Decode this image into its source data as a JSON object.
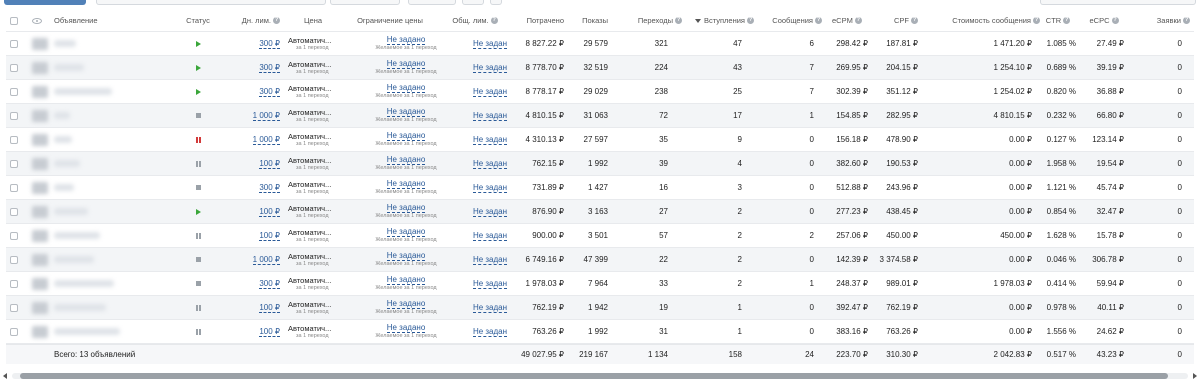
{
  "header": {
    "ad": "Объявление",
    "status": "Статус",
    "daily_limit": "Дн. лим.",
    "price": "Цена",
    "price_limit": "Ограничение цены",
    "total_limit": "Общ. лим.",
    "spent": "Потрачено",
    "impressions": "Показы",
    "clicks": "Переходы",
    "joins": "Вступления",
    "messages": "Сообщения",
    "ecpm": "eCPM",
    "cpf": "CPF",
    "message_cost": "Стоимость сообщения",
    "ctr": "CTR",
    "ecpc": "eCPC",
    "leads": "Заявки",
    "help_glyph": "?"
  },
  "price_main": "Автоматич...",
  "price_sub": "за 1 переход",
  "price_limit_link": "Не задано",
  "price_limit_sub": "Желаемое за 1 переход",
  "total_limit_link": "Не задан",
  "rows": [
    {
      "status": "play",
      "daily": "300 ₽",
      "spent": "8 827.22 ₽",
      "impr": "29 579",
      "clicks": "321",
      "joins": "47",
      "msgs": "6",
      "ecpm": "298.42 ₽",
      "cpf": "187.81 ₽",
      "mcost": "1 471.20 ₽",
      "ctr": "1.085 %",
      "ecpc": "27.49 ₽",
      "leads": "0"
    },
    {
      "status": "play",
      "daily": "300 ₽",
      "spent": "8 778.70 ₽",
      "impr": "32 519",
      "clicks": "224",
      "joins": "43",
      "msgs": "7",
      "ecpm": "269.95 ₽",
      "cpf": "204.15 ₽",
      "mcost": "1 254.10 ₽",
      "ctr": "0.689 %",
      "ecpc": "39.19 ₽",
      "leads": "0"
    },
    {
      "status": "play",
      "daily": "300 ₽",
      "spent": "8 778.17 ₽",
      "impr": "29 029",
      "clicks": "238",
      "joins": "25",
      "msgs": "7",
      "ecpm": "302.39 ₽",
      "cpf": "351.12 ₽",
      "mcost": "1 254.02 ₽",
      "ctr": "0.820 %",
      "ecpc": "36.88 ₽",
      "leads": "0"
    },
    {
      "status": "stop",
      "daily": "1 000 ₽",
      "spent": "4 810.15 ₽",
      "impr": "31 063",
      "clicks": "72",
      "joins": "17",
      "msgs": "1",
      "ecpm": "154.85 ₽",
      "cpf": "282.95 ₽",
      "mcost": "4 810.15 ₽",
      "ctr": "0.232 %",
      "ecpc": "66.80 ₽",
      "leads": "0"
    },
    {
      "status": "pause-red",
      "daily": "1 000 ₽",
      "spent": "4 310.13 ₽",
      "impr": "27 597",
      "clicks": "35",
      "joins": "9",
      "msgs": "0",
      "ecpm": "156.18 ₽",
      "cpf": "478.90 ₽",
      "mcost": "0.00 ₽",
      "ctr": "0.127 %",
      "ecpc": "123.14 ₽",
      "leads": "0"
    },
    {
      "status": "pause",
      "daily": "100 ₽",
      "spent": "762.15 ₽",
      "impr": "1 992",
      "clicks": "39",
      "joins": "4",
      "msgs": "0",
      "ecpm": "382.60 ₽",
      "cpf": "190.53 ₽",
      "mcost": "0.00 ₽",
      "ctr": "1.958 %",
      "ecpc": "19.54 ₽",
      "leads": "0"
    },
    {
      "status": "stop",
      "daily": "300 ₽",
      "spent": "731.89 ₽",
      "impr": "1 427",
      "clicks": "16",
      "joins": "3",
      "msgs": "0",
      "ecpm": "512.88 ₽",
      "cpf": "243.96 ₽",
      "mcost": "0.00 ₽",
      "ctr": "1.121 %",
      "ecpc": "45.74 ₽",
      "leads": "0"
    },
    {
      "status": "play",
      "daily": "100 ₽",
      "spent": "876.90 ₽",
      "impr": "3 163",
      "clicks": "27",
      "joins": "2",
      "msgs": "0",
      "ecpm": "277.23 ₽",
      "cpf": "438.45 ₽",
      "mcost": "0.00 ₽",
      "ctr": "0.854 %",
      "ecpc": "32.47 ₽",
      "leads": "0"
    },
    {
      "status": "pause",
      "daily": "100 ₽",
      "spent": "900.00 ₽",
      "impr": "3 501",
      "clicks": "57",
      "joins": "2",
      "msgs": "2",
      "ecpm": "257.06 ₽",
      "cpf": "450.00 ₽",
      "mcost": "450.00 ₽",
      "ctr": "1.628 %",
      "ecpc": "15.78 ₽",
      "leads": "0"
    },
    {
      "status": "stop",
      "daily": "1 000 ₽",
      "spent": "6 749.16 ₽",
      "impr": "47 399",
      "clicks": "22",
      "joins": "2",
      "msgs": "0",
      "ecpm": "142.39 ₽",
      "cpf": "3 374.58 ₽",
      "mcost": "0.00 ₽",
      "ctr": "0.046 %",
      "ecpc": "306.78 ₽",
      "leads": "0"
    },
    {
      "status": "stop",
      "daily": "300 ₽",
      "spent": "1 978.03 ₽",
      "impr": "7 964",
      "clicks": "33",
      "joins": "2",
      "msgs": "1",
      "ecpm": "248.37 ₽",
      "cpf": "989.01 ₽",
      "mcost": "1 978.03 ₽",
      "ctr": "0.414 %",
      "ecpc": "59.94 ₽",
      "leads": "0"
    },
    {
      "status": "pause",
      "daily": "100 ₽",
      "spent": "762.19 ₽",
      "impr": "1 942",
      "clicks": "19",
      "joins": "1",
      "msgs": "0",
      "ecpm": "392.47 ₽",
      "cpf": "762.19 ₽",
      "mcost": "0.00 ₽",
      "ctr": "0.978 %",
      "ecpc": "40.11 ₽",
      "leads": "0"
    },
    {
      "status": "pause",
      "daily": "100 ₽",
      "spent": "763.26 ₽",
      "impr": "1 992",
      "clicks": "31",
      "joins": "1",
      "msgs": "0",
      "ecpm": "383.16 ₽",
      "cpf": "763.26 ₽",
      "mcost": "0.00 ₽",
      "ctr": "1.556 %",
      "ecpc": "24.62 ₽",
      "leads": "0"
    }
  ],
  "totals": {
    "label": "Всего: 13 объявлений",
    "spent": "49 027.95 ₽",
    "impr": "219 167",
    "clicks": "1 134",
    "joins": "158",
    "msgs": "24",
    "ecpm": "223.70 ₽",
    "cpf": "310.30 ₽",
    "mcost": "2 042.83 ₽",
    "ctr": "0.517 %",
    "ecpc": "43.23 ₽",
    "leads": "0"
  },
  "colors": {
    "play": "#3aa63a",
    "pause": "#9aa1a8",
    "pause_red": "#d23a3a",
    "link": "#2a5a98"
  }
}
